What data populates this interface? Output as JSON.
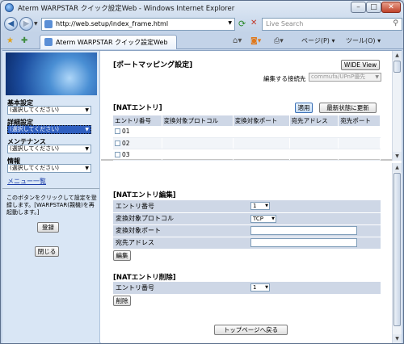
{
  "window": {
    "title": "Aterm WARPSTAR クイック設定Web - Windows Internet Explorer",
    "min_glyph": "–",
    "max_glyph": "□",
    "close_glyph": "✕"
  },
  "addressbar": {
    "back_glyph": "◀",
    "forward_glyph": "▶",
    "url": "http://web.setup/index_frame.html",
    "search_placeholder": "Live Search"
  },
  "tabs": {
    "active_label": "Aterm WARPSTAR クイック設定Web"
  },
  "toolbar": {
    "page_label": "ページ(P) ▾",
    "tools_label": "ツール(O) ▾"
  },
  "sidebar": {
    "sections": [
      {
        "label": "基本設定",
        "value": "(選択してください)"
      },
      {
        "label": "詳細設定",
        "value": "(選択してください)"
      },
      {
        "label": "メンテナンス",
        "value": "(選択してください)"
      },
      {
        "label": "情報",
        "value": "(選択してください)"
      }
    ],
    "menu_list_link": "メニュー一覧",
    "note": "このボタンをクリックして設定を登録します。[WARPSTAR(親機)を再起動します。]",
    "register_button": "登録",
    "close_button": "閉じる"
  },
  "top_frame": {
    "title": "[ポートマッピング設定]",
    "wide_view_button": "WIDE View",
    "connection_label": "編集する接続先",
    "connection_value": "commufa/UPnP優先",
    "nat_section_title": "[NATエントリ]",
    "apply_button": "適用",
    "refresh_button": "最新状態に更新",
    "columns": [
      "エントリ番号",
      "変換対象プロトコル",
      "変換対象ポート",
      "宛先アドレス",
      "宛先ポート"
    ],
    "rows": [
      {
        "entry": "01"
      },
      {
        "entry": "02"
      },
      {
        "entry": "03"
      }
    ]
  },
  "bottom_frame": {
    "edit_title": "[NATエントリ編集]",
    "edit_fields": {
      "entry_label": "エントリ番号",
      "entry_value": "1",
      "protocol_label": "変換対象プロトコル",
      "protocol_value": "TCP",
      "port_label": "変換対象ポート",
      "port_value": "",
      "dest_label": "宛先アドレス",
      "dest_value": ""
    },
    "edit_button": "編集",
    "delete_title": "[NATエントリ削除]",
    "delete_entry_label": "エントリ番号",
    "delete_entry_value": "1",
    "delete_button": "削除",
    "top_page_button": "トップページへ戻る"
  }
}
